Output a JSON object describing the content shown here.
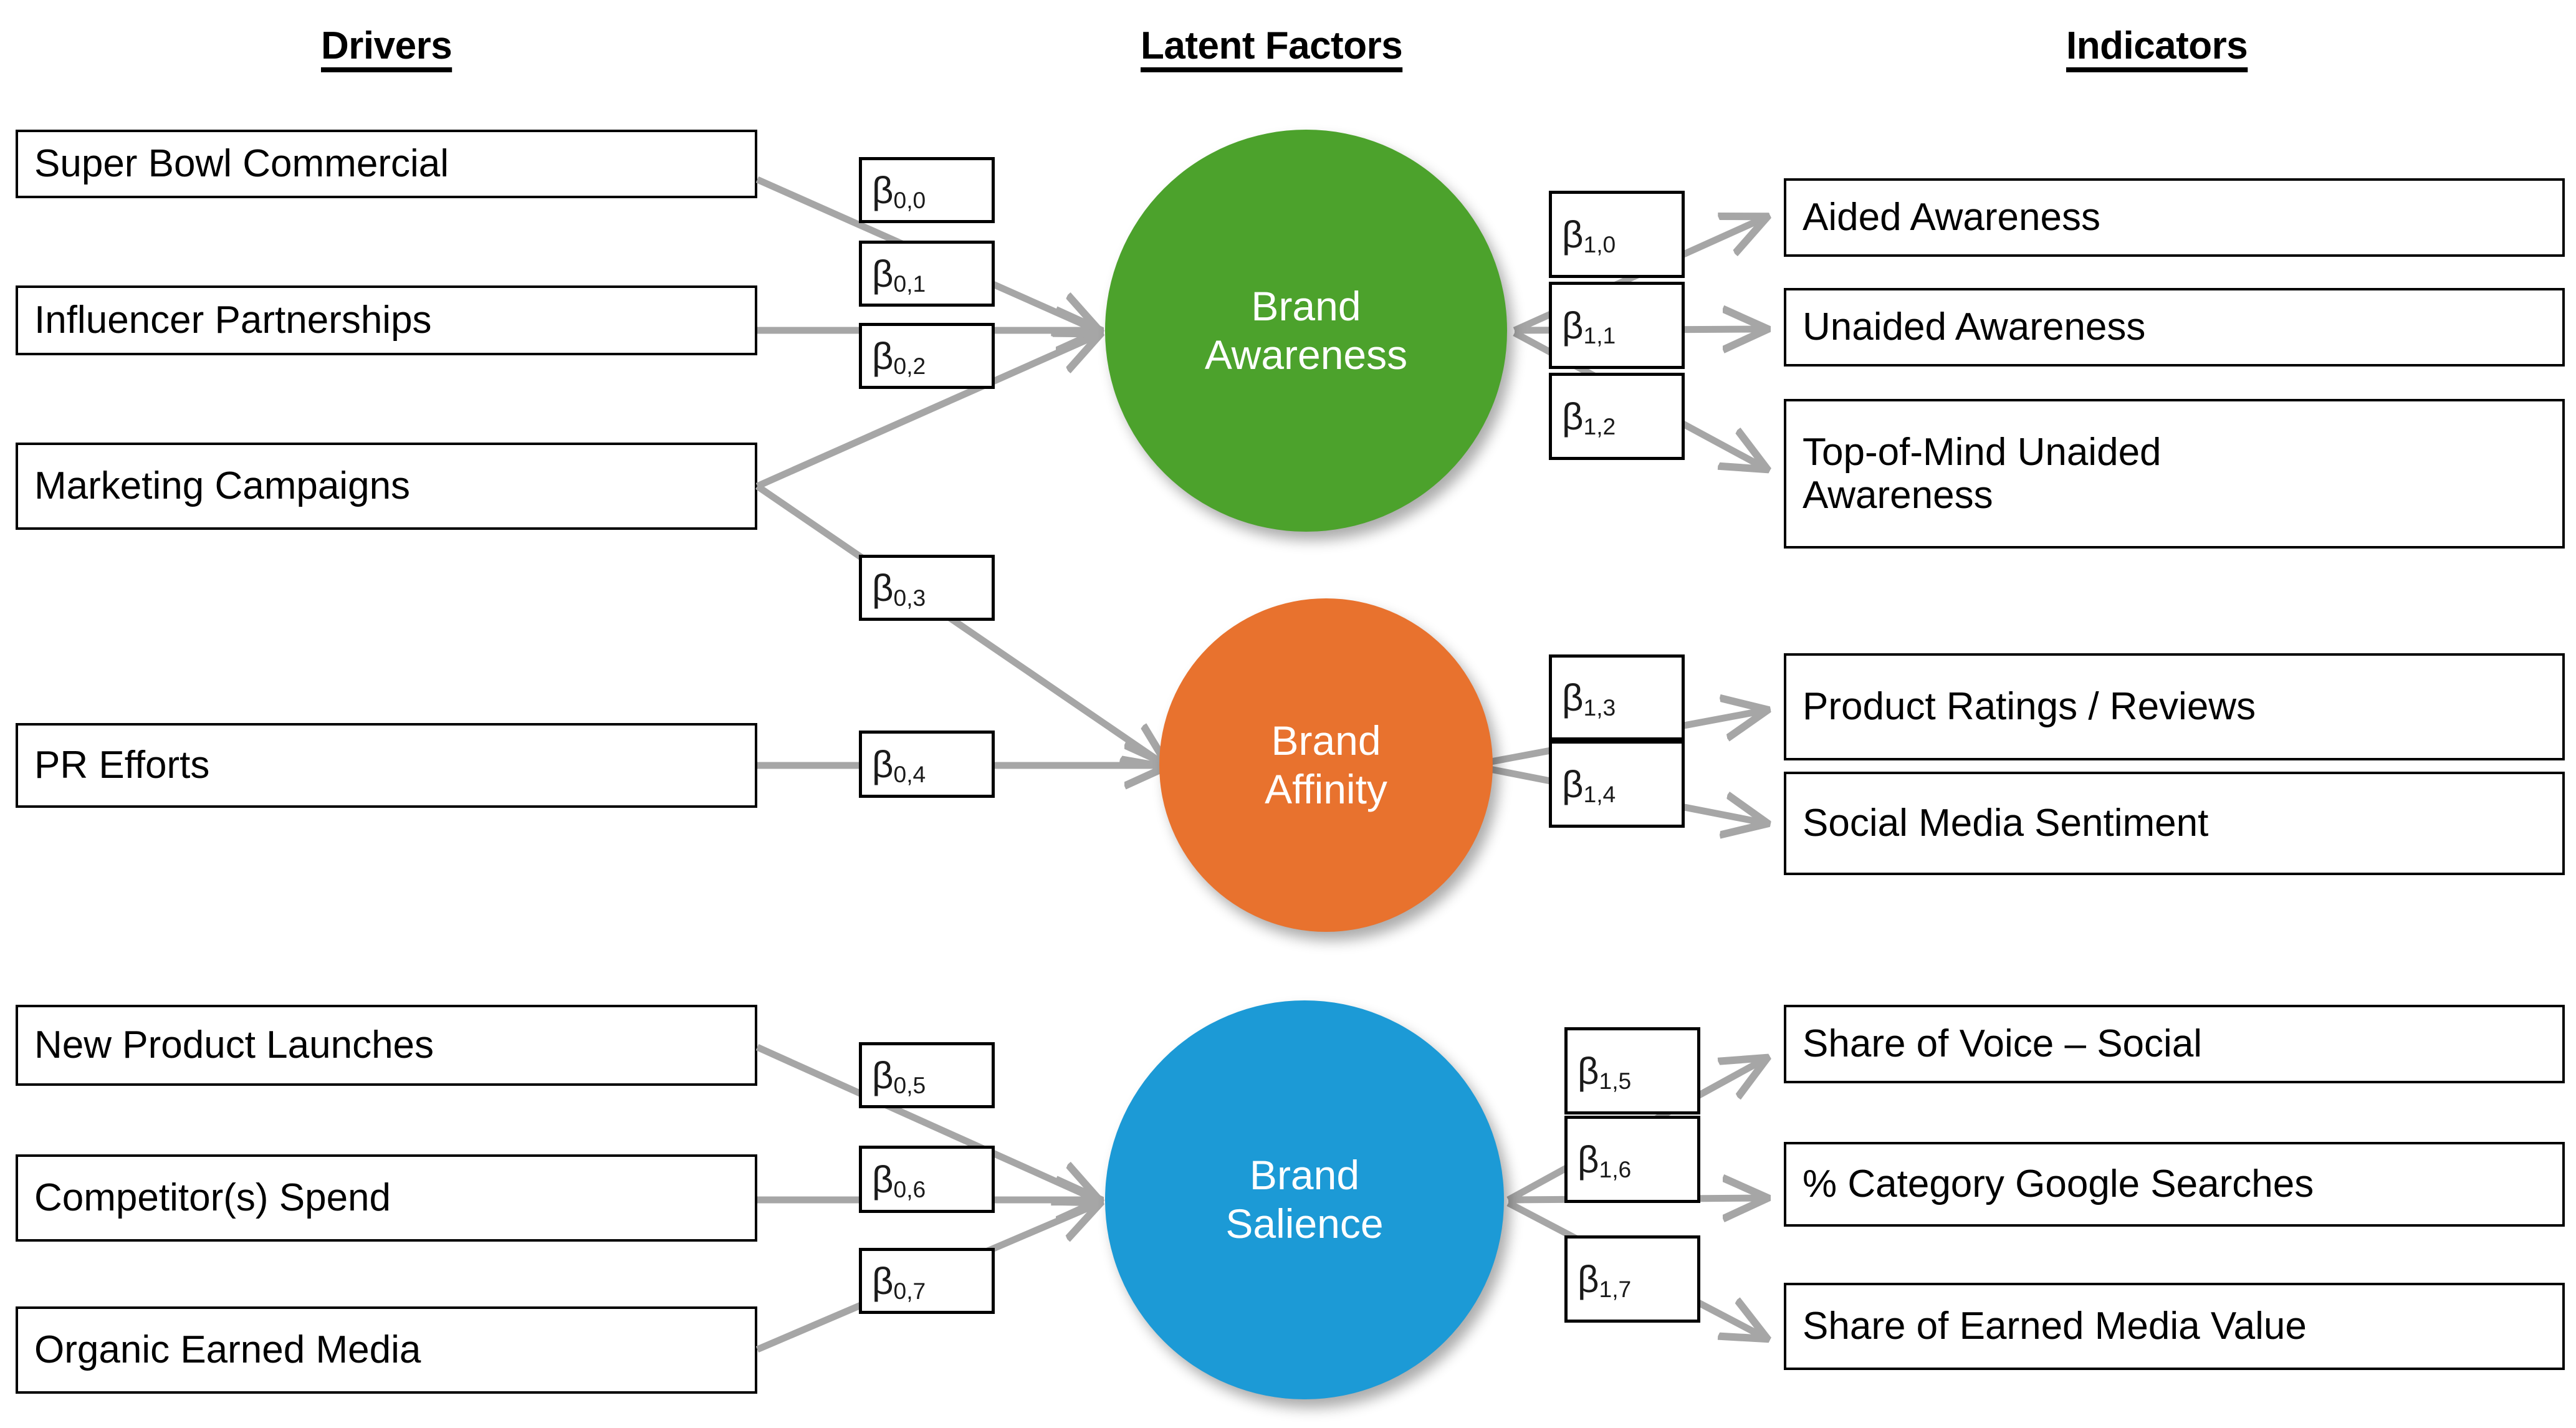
{
  "headers": {
    "drivers": "Drivers",
    "latent_factors": "Latent Factors",
    "indicators": "Indicators"
  },
  "colors": {
    "brand_awareness": "#4CA22C",
    "brand_affinity": "#E8722E",
    "brand_salience": "#1C9AD6",
    "connector": "#A6A6A6",
    "box_border": "#000000",
    "background": "#FFFFFF"
  },
  "drivers": [
    {
      "id": "driver-0",
      "label": "Super Bowl Commercial"
    },
    {
      "id": "driver-1",
      "label": "Influencer Partnerships"
    },
    {
      "id": "driver-2",
      "label": "Marketing Campaigns"
    },
    {
      "id": "driver-3",
      "label": "PR Efforts"
    },
    {
      "id": "driver-4",
      "label": "New Product Launches"
    },
    {
      "id": "driver-5",
      "label": "Competitor(s) Spend"
    },
    {
      "id": "driver-6",
      "label": "Organic Earned Media"
    }
  ],
  "latent_factors": [
    {
      "id": "factor-awareness",
      "label": "Brand\nAwareness",
      "color": "#4CA22C"
    },
    {
      "id": "factor-affinity",
      "label": "Brand\nAffinity",
      "color": "#E8722E"
    },
    {
      "id": "factor-salience",
      "label": "Brand\nSalience",
      "color": "#1C9AD6"
    }
  ],
  "indicators": [
    {
      "id": "indicator-0",
      "label": "Aided Awareness"
    },
    {
      "id": "indicator-1",
      "label": "Unaided Awareness"
    },
    {
      "id": "indicator-2",
      "label": "Top-of-Mind Unaided\nAwareness"
    },
    {
      "id": "indicator-3",
      "label": "Product Ratings / Reviews"
    },
    {
      "id": "indicator-4",
      "label": "Social Media Sentiment"
    },
    {
      "id": "indicator-5",
      "label": "Share of Voice – Social"
    },
    {
      "id": "indicator-6",
      "label": "% Category Google Searches"
    },
    {
      "id": "indicator-7",
      "label": "Share of Earned Media Value"
    }
  ],
  "driver_coefficients": [
    {
      "id": "beta-0-0",
      "symbol": "β",
      "sub": "0,0"
    },
    {
      "id": "beta-0-1",
      "symbol": "β",
      "sub": "0,1"
    },
    {
      "id": "beta-0-2",
      "symbol": "β",
      "sub": "0,2"
    },
    {
      "id": "beta-0-3",
      "symbol": "β",
      "sub": "0,3"
    },
    {
      "id": "beta-0-4",
      "symbol": "β",
      "sub": "0,4"
    },
    {
      "id": "beta-0-5",
      "symbol": "β",
      "sub": "0,5"
    },
    {
      "id": "beta-0-6",
      "symbol": "β",
      "sub": "0,6"
    },
    {
      "id": "beta-0-7",
      "symbol": "β",
      "sub": "0,7"
    }
  ],
  "indicator_coefficients": [
    {
      "id": "beta-1-0",
      "symbol": "β",
      "sub": "1,0"
    },
    {
      "id": "beta-1-1",
      "symbol": "β",
      "sub": "1,1"
    },
    {
      "id": "beta-1-2",
      "symbol": "β",
      "sub": "1,2"
    },
    {
      "id": "beta-1-3",
      "symbol": "β",
      "sub": "1,3"
    },
    {
      "id": "beta-1-4",
      "symbol": "β",
      "sub": "1,4"
    },
    {
      "id": "beta-1-5",
      "symbol": "β",
      "sub": "1,5"
    },
    {
      "id": "beta-1-6",
      "symbol": "β",
      "sub": "1,6"
    },
    {
      "id": "beta-1-7",
      "symbol": "β",
      "sub": "1,7"
    }
  ],
  "chart_data": {
    "type": "diagram",
    "title": "Brand Measurement Structural Model",
    "columns": [
      "Drivers",
      "Latent Factors",
      "Indicators"
    ],
    "nodes": {
      "drivers": [
        "Super Bowl Commercial",
        "Influencer Partnerships",
        "Marketing Campaigns",
        "PR Efforts",
        "New Product Launches",
        "Competitor(s) Spend",
        "Organic Earned Media"
      ],
      "latent_factors": [
        "Brand Awareness",
        "Brand Affinity",
        "Brand Salience"
      ],
      "indicators": [
        "Aided Awareness",
        "Unaided Awareness",
        "Top-of-Mind Unaided Awareness",
        "Product Ratings / Reviews",
        "Social Media Sentiment",
        "Share of Voice – Social",
        "% Category Google Searches",
        "Share of Earned Media Value"
      ]
    },
    "edges": [
      {
        "from": "Super Bowl Commercial",
        "to": "Brand Awareness",
        "weight": "β0,0"
      },
      {
        "from": "Influencer Partnerships",
        "to": "Brand Awareness",
        "weight": "β0,1"
      },
      {
        "from": "Marketing Campaigns",
        "to": "Brand Awareness",
        "weight": "β0,2"
      },
      {
        "from": "Marketing Campaigns",
        "to": "Brand Affinity",
        "weight": "β0,3"
      },
      {
        "from": "PR Efforts",
        "to": "Brand Affinity",
        "weight": "β0,4"
      },
      {
        "from": "New Product Launches",
        "to": "Brand Salience",
        "weight": "β0,5"
      },
      {
        "from": "Competitor(s) Spend",
        "to": "Brand Salience",
        "weight": "β0,6"
      },
      {
        "from": "Organic Earned Media",
        "to": "Brand Salience",
        "weight": "β0,7"
      },
      {
        "from": "Brand Awareness",
        "to": "Aided Awareness",
        "weight": "β1,0"
      },
      {
        "from": "Brand Awareness",
        "to": "Unaided Awareness",
        "weight": "β1,1"
      },
      {
        "from": "Brand Awareness",
        "to": "Top-of-Mind Unaided Awareness",
        "weight": "β1,2"
      },
      {
        "from": "Brand Affinity",
        "to": "Product Ratings / Reviews",
        "weight": "β1,3"
      },
      {
        "from": "Brand Affinity",
        "to": "Social Media Sentiment",
        "weight": "β1,4"
      },
      {
        "from": "Brand Salience",
        "to": "Share of Voice – Social",
        "weight": "β1,5"
      },
      {
        "from": "Brand Salience",
        "to": "% Category Google Searches",
        "weight": "β1,6"
      },
      {
        "from": "Brand Salience",
        "to": "Share of Earned Media Value",
        "weight": "β1,7"
      }
    ]
  }
}
